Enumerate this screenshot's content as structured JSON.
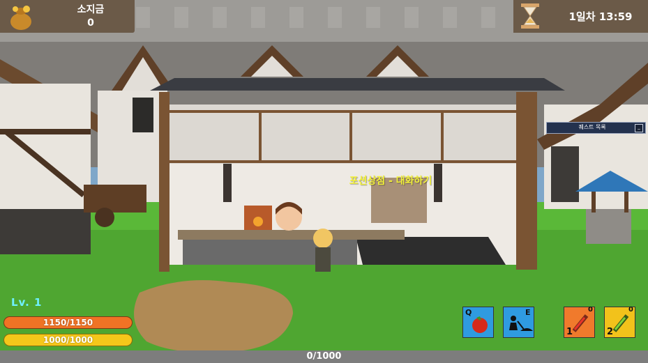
{
  "hud": {
    "gold_label": "소지금",
    "gold_value": "0",
    "time_text": "1일차 13:59",
    "quest_list_label": "퀘스트 목록",
    "quest_minimize": "_",
    "npc_prompt": "포션상점 - 대화하기",
    "level_text": "Lv.   1",
    "hp_text": "1150/1150",
    "hp_fraction": 1.0,
    "mp_text": "1000/1000",
    "mp_fraction": 1.0,
    "exp_text": "0/1000",
    "exp_fraction": 0.0
  },
  "skills": [
    {
      "key": "Q",
      "icon": "tomato-icon",
      "color": "#2f9be0"
    },
    {
      "key": "E",
      "icon": "dig-icon",
      "color": "#2f9be0"
    },
    {
      "num": "1",
      "count": "0",
      "icon": "red-potion-icon",
      "color": "#f07a2c"
    },
    {
      "num": "2",
      "count": "0",
      "icon": "green-potion-icon",
      "color": "#f2c21b"
    }
  ],
  "colors": {
    "panel": "#6b5a48",
    "hp": "#f07325",
    "mp": "#f5c71a",
    "level": "#6ff0ff",
    "prompt": "#f2f03a"
  }
}
